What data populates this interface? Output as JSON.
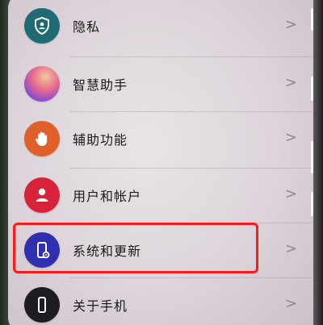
{
  "settings": {
    "items": [
      {
        "label": "隐私",
        "icon": "shield-person-icon",
        "color": "#1f6a73"
      },
      {
        "label": "智慧助手",
        "icon": "assistant-orb-icon",
        "color": "#b14fb0"
      },
      {
        "label": "辅助功能",
        "icon": "hand-icon",
        "color": "#e0602a"
      },
      {
        "label": "用户和帐户",
        "icon": "user-icon",
        "color": "#d8223a"
      },
      {
        "label": "系统和更新",
        "icon": "phone-settings-icon",
        "color": "#2f2fb0"
      },
      {
        "label": "关于手机",
        "icon": "phone-icon",
        "color": "#1c1c22"
      }
    ],
    "chevron": ">"
  },
  "highlight_color": "#ff1a1a"
}
